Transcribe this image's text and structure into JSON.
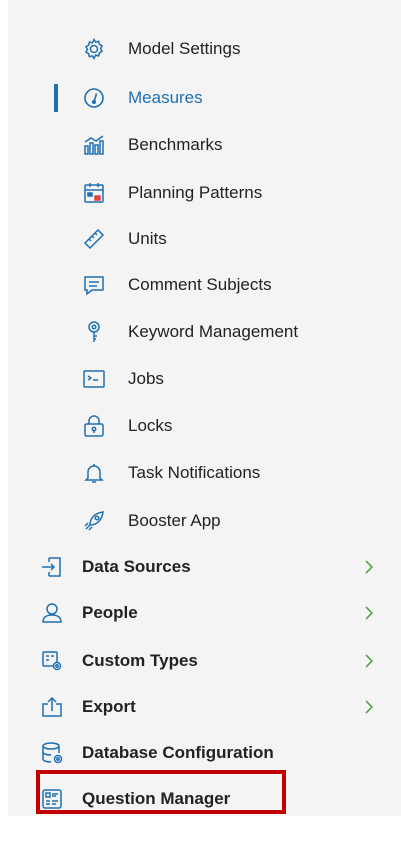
{
  "colors": {
    "accent": "#1f6fb2",
    "highlight": "#c00000",
    "chevron": "#5aa84a"
  },
  "sub_items": [
    {
      "label": "Model Settings",
      "icon": "gear-icon"
    },
    {
      "label": "Measures",
      "icon": "gauge-icon",
      "active": true
    },
    {
      "label": "Benchmarks",
      "icon": "benchmark-chart-icon"
    },
    {
      "label": "Planning Patterns",
      "icon": "calendar-icon"
    },
    {
      "label": "Units",
      "icon": "ruler-icon"
    },
    {
      "label": "Comment Subjects",
      "icon": "comment-icon"
    },
    {
      "label": "Keyword Management",
      "icon": "key-icon"
    },
    {
      "label": "Jobs",
      "icon": "terminal-icon"
    },
    {
      "label": "Locks",
      "icon": "lock-icon"
    },
    {
      "label": "Task Notifications",
      "icon": "bell-icon"
    },
    {
      "label": "Booster App",
      "icon": "rocket-icon"
    }
  ],
  "main_items": [
    {
      "label": "Data Sources",
      "icon": "import-icon",
      "has_chevron": true
    },
    {
      "label": "People",
      "icon": "person-icon",
      "has_chevron": true
    },
    {
      "label": "Custom Types",
      "icon": "custom-types-icon",
      "has_chevron": true
    },
    {
      "label": "Export",
      "icon": "export-icon",
      "has_chevron": true
    },
    {
      "label": "Database Configuration",
      "icon": "database-config-icon",
      "has_chevron": false
    },
    {
      "label": "Question Manager",
      "icon": "question-manager-icon",
      "has_chevron": false,
      "highlighted": true
    }
  ]
}
